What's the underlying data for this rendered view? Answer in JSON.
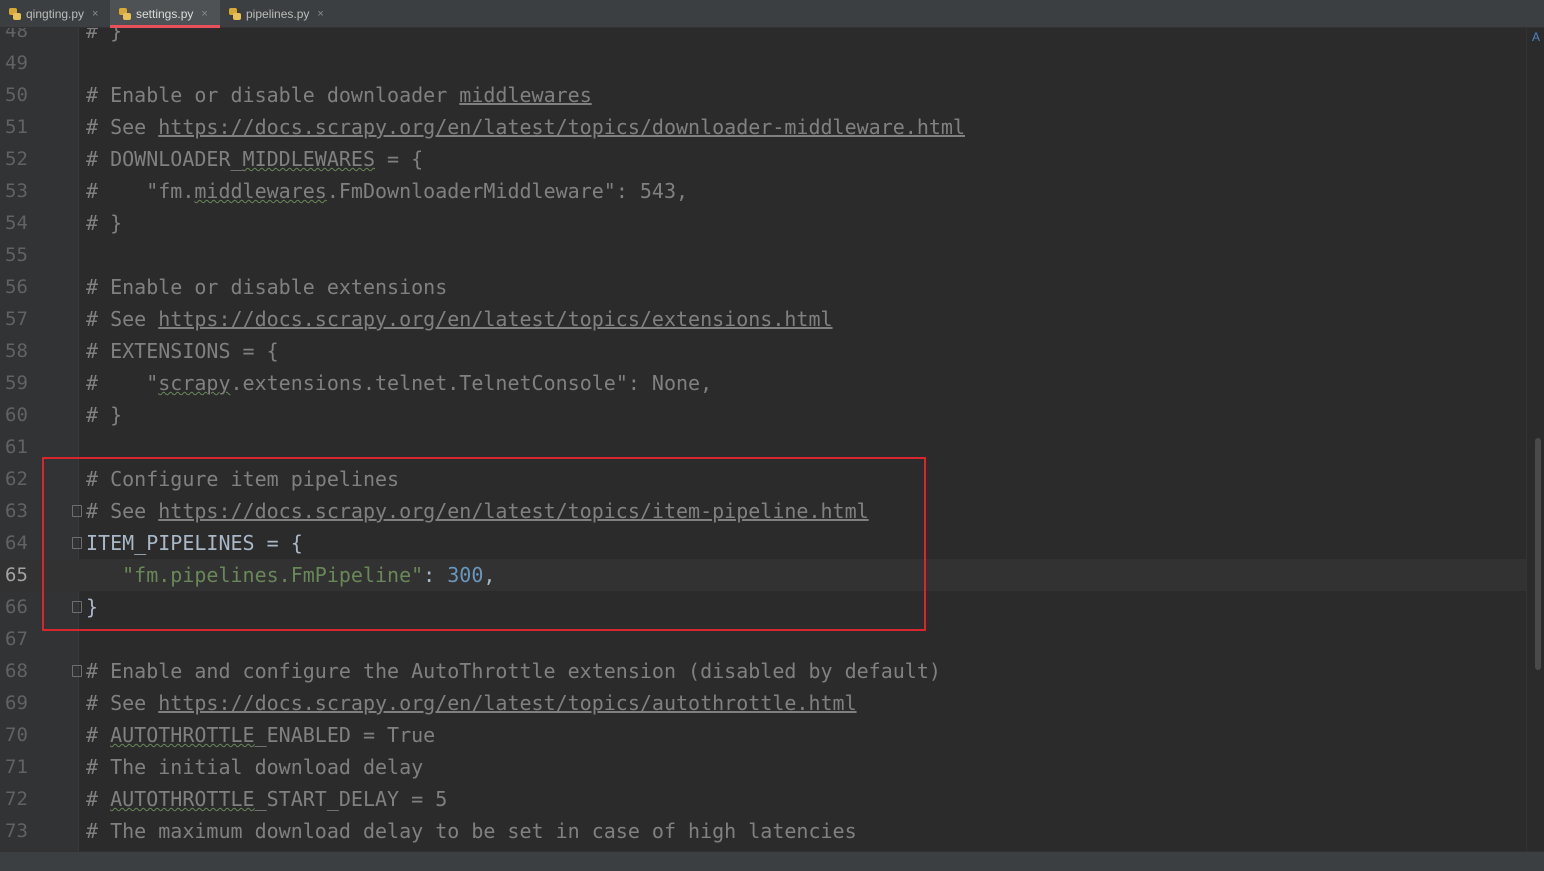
{
  "tabs": [
    {
      "label": "qingting.py",
      "close": "×",
      "active": false
    },
    {
      "label": "settings.py",
      "close": "×",
      "active": true
    },
    {
      "label": "pipelines.py",
      "close": "×",
      "active": false
    }
  ],
  "current_line": "65",
  "lines": [
    {
      "n": "48",
      "segments": [
        {
          "t": "# }",
          "c": "c"
        }
      ]
    },
    {
      "n": "49",
      "segments": []
    },
    {
      "n": "50",
      "segments": [
        {
          "t": "# Enable or disable downloader ",
          "c": "c"
        },
        {
          "t": "middlewares",
          "c": "c u"
        }
      ]
    },
    {
      "n": "51",
      "segments": [
        {
          "t": "# See ",
          "c": "c"
        },
        {
          "t": "https://docs.scrapy.org/en/latest/topics/downloader-middleware.html",
          "c": "c u"
        }
      ]
    },
    {
      "n": "52",
      "segments": [
        {
          "t": "# DOWNLOADER_",
          "c": "c"
        },
        {
          "t": "MIDDLEWARES",
          "c": "c w"
        },
        {
          "t": " = {",
          "c": "c"
        }
      ]
    },
    {
      "n": "53",
      "segments": [
        {
          "t": "#    \"fm.",
          "c": "c"
        },
        {
          "t": "middlewares",
          "c": "c w"
        },
        {
          "t": ".FmDownloaderMiddleware\": 543,",
          "c": "c"
        }
      ]
    },
    {
      "n": "54",
      "segments": [
        {
          "t": "# }",
          "c": "c"
        }
      ]
    },
    {
      "n": "55",
      "segments": []
    },
    {
      "n": "56",
      "segments": [
        {
          "t": "# Enable or disable extensions",
          "c": "c"
        }
      ]
    },
    {
      "n": "57",
      "segments": [
        {
          "t": "# See ",
          "c": "c"
        },
        {
          "t": "https://docs.scrapy.org/en/latest/topics/extensions.html",
          "c": "c u"
        }
      ]
    },
    {
      "n": "58",
      "segments": [
        {
          "t": "# EXTENSIONS = {",
          "c": "c"
        }
      ]
    },
    {
      "n": "59",
      "segments": [
        {
          "t": "#    \"",
          "c": "c"
        },
        {
          "t": "scrapy",
          "c": "c w"
        },
        {
          "t": ".extensions.telnet.TelnetConsole\": None,",
          "c": "c"
        }
      ]
    },
    {
      "n": "60",
      "segments": [
        {
          "t": "# }",
          "c": "c"
        }
      ]
    },
    {
      "n": "61",
      "segments": []
    },
    {
      "n": "62",
      "segments": [
        {
          "t": "# Configure item pipelines",
          "c": "c"
        }
      ]
    },
    {
      "n": "63",
      "fold": true,
      "segments": [
        {
          "t": "# See ",
          "c": "c"
        },
        {
          "t": "https://docs.scrapy.org/en/latest/topics/item-pipeline.html",
          "c": "c u"
        }
      ]
    },
    {
      "n": "64",
      "fold": true,
      "segments": [
        {
          "t": "ITEM_PIPELINES = {",
          "c": ""
        }
      ]
    },
    {
      "n": "65",
      "segments": [
        {
          "t": "   ",
          "c": ""
        },
        {
          "t": "\"fm.pipelines.FmPipeline\"",
          "c": "s"
        },
        {
          "t": ": ",
          "c": ""
        },
        {
          "t": "300",
          "c": "n"
        },
        {
          "t": ",",
          "c": ""
        }
      ]
    },
    {
      "n": "66",
      "fold": true,
      "segments": [
        {
          "t": "}",
          "c": ""
        }
      ]
    },
    {
      "n": "67",
      "segments": []
    },
    {
      "n": "68",
      "fold": true,
      "segments": [
        {
          "t": "# Enable and configure the AutoThrottle extension (disabled by default)",
          "c": "c"
        }
      ]
    },
    {
      "n": "69",
      "segments": [
        {
          "t": "# See ",
          "c": "c"
        },
        {
          "t": "https://docs.scrapy.org/en/latest/topics/autothrottle.html",
          "c": "c u"
        }
      ]
    },
    {
      "n": "70",
      "segments": [
        {
          "t": "# ",
          "c": "c"
        },
        {
          "t": "AUTOTHROTTLE",
          "c": "c w"
        },
        {
          "t": "_ENABLED = True",
          "c": "c"
        }
      ]
    },
    {
      "n": "71",
      "segments": [
        {
          "t": "# The initial download delay",
          "c": "c"
        }
      ]
    },
    {
      "n": "72",
      "segments": [
        {
          "t": "# ",
          "c": "c"
        },
        {
          "t": "AUTOTHROTTLE",
          "c": "c w"
        },
        {
          "t": "_START_DELAY = 5",
          "c": "c"
        }
      ]
    },
    {
      "n": "73",
      "segments": [
        {
          "t": "# The maximum download delay to be set in case of high latencies",
          "c": "c"
        }
      ]
    }
  ]
}
